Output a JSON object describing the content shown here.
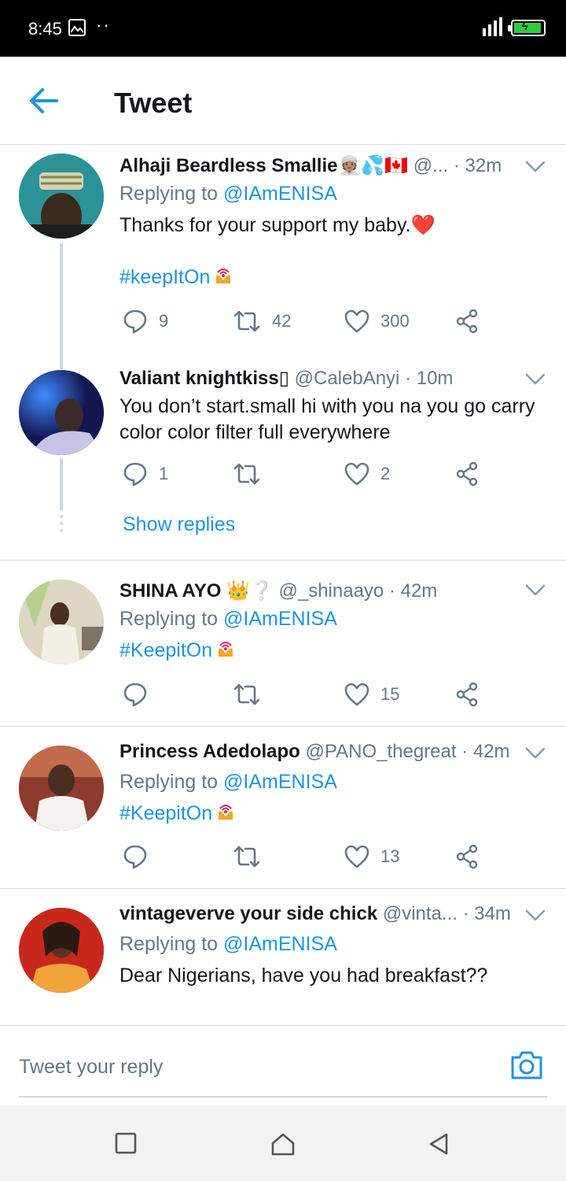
{
  "status_bar": {
    "time": "8:45",
    "dots": "··"
  },
  "header": {
    "title": "Tweet"
  },
  "tweets": [
    {
      "name": "Alhaji Beardless Smallie",
      "name_emoji": "👳🏽💦🇨🇦",
      "handle": "@...",
      "time": "· 32m",
      "replying_prefix": "Replying to",
      "replying_to": "@IAmENISA",
      "text": "Thanks for your support my baby.❤️",
      "hashtag": "#keepItOn",
      "replies": "9",
      "retweets": "42",
      "likes": "300"
    },
    {
      "name": "Valiant knightkiss",
      "name_emoji": "▯",
      "handle": "@CalebAnyi",
      "time": "· 10m",
      "text": "You don’t start.small hi with you na you go carry color color filter full everywhere",
      "replies": "1",
      "retweets": "",
      "likes": "2",
      "show_replies": "Show replies"
    },
    {
      "name": "SHINA AYO",
      "name_emoji": "👑❔",
      "handle": "@_shinaayo",
      "time": "· 42m",
      "replying_prefix": "Replying to",
      "replying_to": "@IAmENISA",
      "hashtag": "#KeepitOn",
      "replies": "",
      "retweets": "",
      "likes": "15"
    },
    {
      "name": "Princess Adedolapo",
      "handle": "@PANO_thegreat",
      "time": "· 42m",
      "replying_prefix": "Replying to",
      "replying_to": "@IAmENISA",
      "hashtag": "#KeepitOn",
      "replies": "",
      "retweets": "",
      "likes": "13"
    },
    {
      "name": "vintageverve your side chick",
      "handle": "@vinta...",
      "time": "· 34m",
      "replying_prefix": "Replying to",
      "replying_to": "@IAmENISA",
      "text": "Dear Nigerians, have you had breakfast??"
    }
  ],
  "reply_bar": {
    "placeholder": "Tweet your reply"
  },
  "colors": {
    "accent": "#1b95e0",
    "muted": "#657786",
    "like_heart": "#e0245e"
  },
  "icons": [
    "back-arrow-icon",
    "chevron-down-icon",
    "reply-icon",
    "retweet-icon",
    "like-icon",
    "share-icon",
    "camera-icon",
    "broadcast-hands-icon",
    "square-nav-icon",
    "home-nav-icon",
    "back-nav-icon"
  ]
}
